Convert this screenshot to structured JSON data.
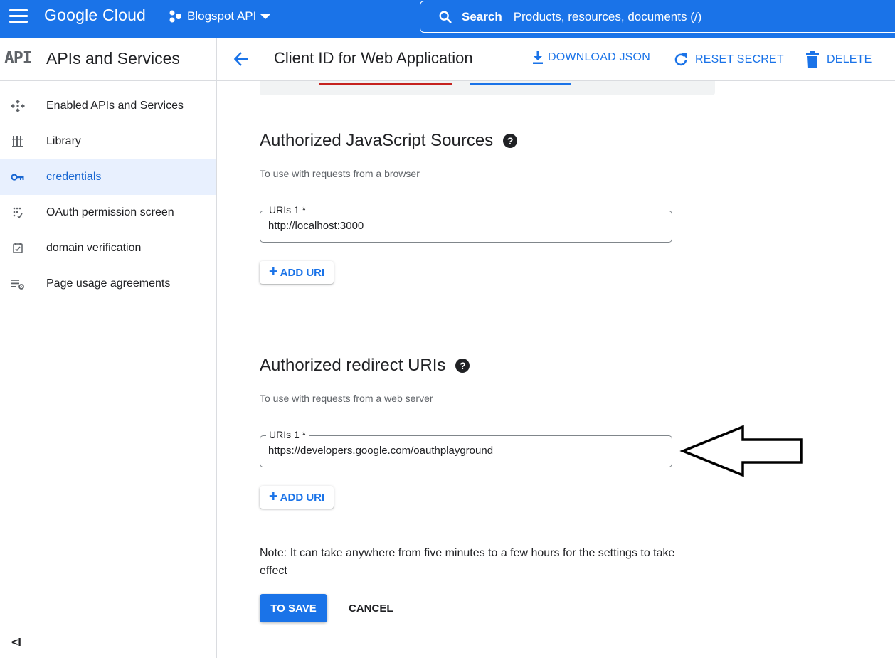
{
  "topbar": {
    "brand": "Google Cloud",
    "project": "Blogspot API",
    "search_label": "Search",
    "search_hint": "Products, resources, documents (/)"
  },
  "sidebar": {
    "logo": "API",
    "title": "APIs and Services",
    "items": [
      {
        "label": "Enabled APIs and Services",
        "icon": "enabled-apis-icon",
        "active": false
      },
      {
        "label": "Library",
        "icon": "library-icon",
        "active": false
      },
      {
        "label": "credentials",
        "icon": "key-icon",
        "active": true
      },
      {
        "label": "OAuth permission screen",
        "icon": "oauth-consent-icon",
        "active": false
      },
      {
        "label": "domain verification",
        "icon": "domain-check-icon",
        "active": false
      },
      {
        "label": "Page usage agreements",
        "icon": "settings-list-icon",
        "active": false
      }
    ],
    "collapse_label": "<I"
  },
  "header": {
    "title": "Client ID for Web Application",
    "download_label": "DOWNLOAD JSON",
    "reset_label": "RESET SECRET",
    "delete_label": "DELETE"
  },
  "js_sources": {
    "title": "Authorized JavaScript Sources",
    "subtitle": "To use with requests from a browser",
    "field_label": "URIs 1 *",
    "field_value": "http://localhost:3000",
    "add_label": "ADD URI"
  },
  "redirect_uris": {
    "title": "Authorized redirect URIs",
    "subtitle": "To use with requests from a web server",
    "field_label": "URIs 1 *",
    "field_value": "https://developers.google.com/oauthplayground",
    "add_label": "ADD URI"
  },
  "note": "Note: It can take anywhere from five minutes to a few hours for the settings to take effect",
  "actions": {
    "save_label": "TO SAVE",
    "cancel_label": "CANCEL"
  },
  "colors": {
    "accent": "#1a73e8",
    "active_bg": "#e8f0fe",
    "active_text": "#1967d2"
  }
}
